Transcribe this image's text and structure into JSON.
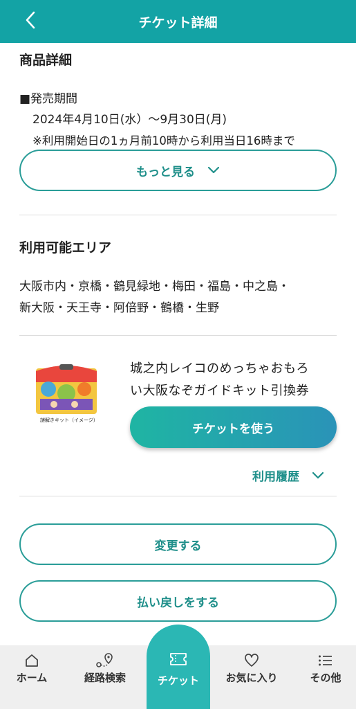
{
  "header": {
    "title": "チケット詳細"
  },
  "product_detail": {
    "title": "商品詳細",
    "sale_period_label": "■発売期間",
    "sale_period_value": "2024年4月10日(水）～9月30日(月)",
    "note": "※利用開始日の1ヵ月前10時から利用当日16時まで",
    "more_label": "もっと見る"
  },
  "area": {
    "title": "利用可能エリア",
    "line1": "大阪市内・京橋・鶴見緑地・梅田・福島・中之島・",
    "line2": "新大阪・天王寺・阿倍野・鶴橋・生野"
  },
  "ticket": {
    "name_line1": "城之内レイコのめっちゃおもろ",
    "name_line2": "い大阪なぞガイドキット引換券",
    "image_caption": "謎解きキット（イメージ）",
    "use_label": "チケットを使う",
    "history_label": "利用履歴"
  },
  "actions": {
    "change_label": "変更する",
    "refund_label": "払い戻しをする"
  },
  "tabbar": {
    "home": "ホーム",
    "route": "経路検索",
    "ticket": "チケット",
    "favorites": "お気に入り",
    "other": "その他"
  },
  "colors": {
    "header": "#13a3a5",
    "accent": "#1f8f8a",
    "tab_active": "#2bb7b4"
  }
}
